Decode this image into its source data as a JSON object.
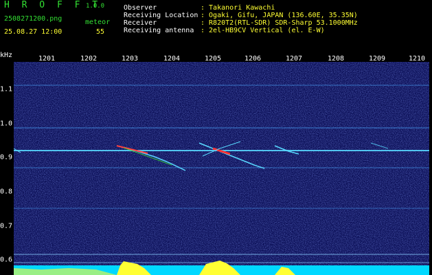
{
  "app": {
    "title": "H R O F F T",
    "version": "1.0.0"
  },
  "file": {
    "name": "2508271200.png",
    "datetime": "25.08.27 12:00"
  },
  "counter": {
    "label": "meteor",
    "value": "55"
  },
  "header": {
    "rows": [
      {
        "label": "Observer",
        "value": ": Takanori Kawachi"
      },
      {
        "label": "Receiving Location",
        "value": ": Ogaki, Gifu, JAPAN (136.60E, 35.35N)"
      },
      {
        "label": "Receiver",
        "value": ": R820T2(RTL-SDR) SDR-Sharp 53.1000MHz"
      },
      {
        "label": "Receiving antenna",
        "value": ": 2el-HB9CV Vertical (el. E-W)"
      }
    ]
  },
  "axes": {
    "y_unit": "kHz",
    "y_ticks": [
      "1.1",
      "1.0",
      "0.9",
      "0.8",
      "0.7",
      "0.6"
    ],
    "x_ticks": [
      "1201",
      "1202",
      "1203",
      "1204",
      "1205",
      "1206",
      "1207",
      "1208",
      "1209",
      "1210"
    ]
  },
  "colors": {
    "background": "#000000",
    "plot_bg": "#0c1058",
    "label_green": "#33e033",
    "value_yellow": "#ffff33",
    "trace_cyan": "#58d8ff",
    "echo_red": "#ff3030",
    "bottom_bar": "#00d8ff"
  }
}
